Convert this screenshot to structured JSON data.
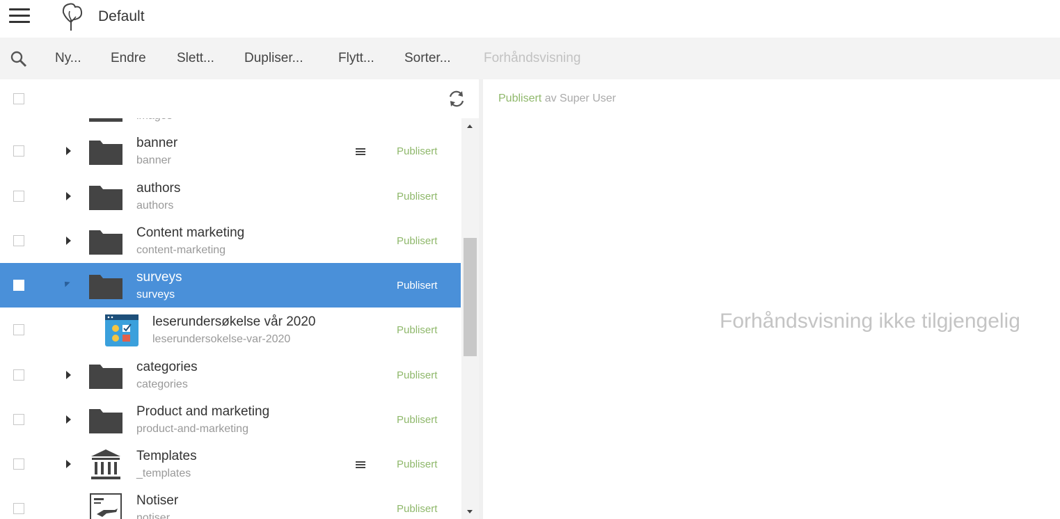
{
  "topbar": {
    "title": "Default"
  },
  "toolbar": {
    "items": [
      {
        "label": "Ny..."
      },
      {
        "label": "Endre"
      },
      {
        "label": "Slett..."
      },
      {
        "label": "Dupliser..."
      },
      {
        "label": "Flytt..."
      },
      {
        "label": "Sorter..."
      },
      {
        "label": "Forhåndsvisning"
      }
    ]
  },
  "tree": {
    "partial": {
      "subtitle": "images"
    },
    "rows": [
      {
        "title": "banner",
        "subtitle": "banner",
        "status": "Publisert"
      },
      {
        "title": "authors",
        "subtitle": "authors",
        "status": "Publisert"
      },
      {
        "title": "Content marketing",
        "subtitle": "content-marketing",
        "status": "Publisert"
      },
      {
        "title": "surveys",
        "subtitle": "surveys",
        "status": "Publisert"
      },
      {
        "title": "leserundersøkelse vår 2020",
        "subtitle": "leserundersokelse-var-2020",
        "status": "Publisert"
      },
      {
        "title": "categories",
        "subtitle": "categories",
        "status": "Publisert"
      },
      {
        "title": "Product and marketing",
        "subtitle": "product-and-marketing",
        "status": "Publisert"
      },
      {
        "title": "Templates",
        "subtitle": "_templates",
        "status": "Publisert"
      },
      {
        "title": "Notiser",
        "subtitle": "notiser",
        "status": "Publisert"
      }
    ]
  },
  "preview": {
    "status": "Publisert",
    "by": "av Super User",
    "message": "Forhåndsvisning ikke tilgjengelig"
  },
  "colors": {
    "accent": "#4a90d9",
    "published": "#8fb86b"
  }
}
